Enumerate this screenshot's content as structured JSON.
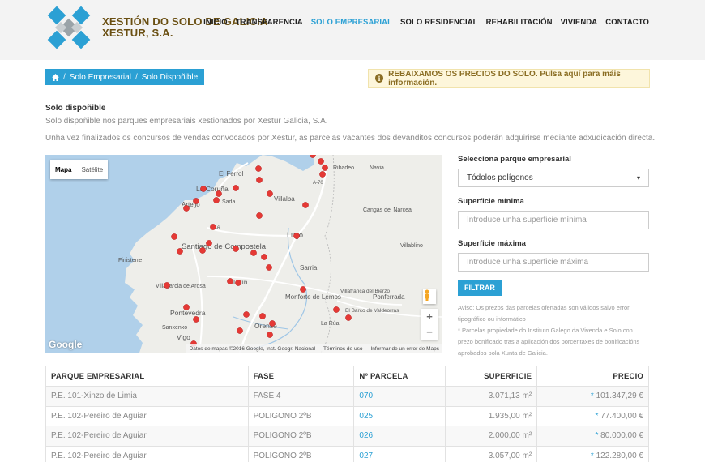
{
  "brand": {
    "line1": "XESTIÓN DO SOLO DE GALICIA",
    "line2": "XESTUR, S.A."
  },
  "nav": [
    {
      "label": "INICIO",
      "active": false
    },
    {
      "label": "TRANSPARENCIA",
      "active": false
    },
    {
      "label": "SOLO EMPRESARIAL",
      "active": true
    },
    {
      "label": "SOLO RESIDENCIAL",
      "active": false
    },
    {
      "label": "REHABILITACIÓN",
      "active": false
    },
    {
      "label": "VIVIENDA",
      "active": false
    },
    {
      "label": "CONTACTO",
      "active": false
    }
  ],
  "breadcrumb": {
    "level1": "Solo Empresarial",
    "level2": "Solo Dispoñible"
  },
  "alert": {
    "text": "REBAIXAMOS OS PRECIOS DO SOLO. Pulsa aquí para máis información."
  },
  "intro": {
    "title": "Solo dispoñible",
    "line1": "Solo dispoñible nos parques empresariais xestionados por Xestur Galicia, S.A.",
    "line2": "Unha vez finalizados os concursos de vendas convocados por Xestur, as parcelas vacantes dos devanditos concursos poderán adquirirse mediante adxudicación directa."
  },
  "map": {
    "type_map": "Mapa",
    "type_sat": "Satélite",
    "google": "Google",
    "attrib1": "Datos de mapas ©2016 Google, Inst. Geogr. Nacional",
    "attrib2": "Términos de uso",
    "attrib3": "Informar de un error de Maps",
    "places": {
      "ferrol": "El Ferrol",
      "coruna": "La Coruña",
      "arteijo": "Arteijo",
      "sada": "Sada",
      "villalba": "Villalba",
      "ribadeo": "Ribadeo",
      "navia": "Navia",
      "cangas": "Cangas del Narcea",
      "lugo": "Lugo",
      "santiago": "Santiago de Compostela",
      "finisterre": "Finisterre",
      "sarria": "Sarria",
      "villablino": "Villablino",
      "villagarcia": "Villagarcia de Arosa",
      "lalin": "Lalín",
      "monforte": "Monforte de Lemos",
      "villafranca": "Villafranca del Bierzo",
      "ponferrada": "Ponferrada",
      "pontevedra": "Pontevedra",
      "barco": "El Barco de Valdeorras",
      "sanxenxo": "Sanxenxo",
      "orense": "Orense",
      "larua": "La Rúa",
      "vigo": "Vigo",
      "a70": "A-70",
      "a6": "A-6"
    }
  },
  "filters": {
    "park_label": "Selecciona parque empresarial",
    "park_value": "Tódolos polígonos",
    "min_label": "Superficie mínima",
    "min_placeholder": "Introduce unha superficie mínima",
    "max_label": "Superficie máxima",
    "max_placeholder": "Introduce unha superficie máxima",
    "button": "FILTRAR",
    "note1": "Aviso: Os prezos das parcelas ofertadas son válidos salvo error tipográfico ou informático",
    "note2": "* Parcelas propiedade do Instituto Galego da Vivenda e Solo con prezo bonificado tras a aplicación dos porcentaxes de bonificacións aprobados pola Xunta de Galicia."
  },
  "table": {
    "headers": [
      "PARQUE EMPRESARIAL",
      "FASE",
      "Nº PARCELA",
      "SUPERFICIE",
      "PRECIO"
    ],
    "rows": [
      {
        "park": "P.E. 101-Xinzo de Limia",
        "phase": "FASE 4",
        "parcel": "070",
        "area": "3.071,13  m²",
        "price": "101.347,29  €"
      },
      {
        "park": "P.E. 102-Pereiro de Aguiar",
        "phase": "POLIGONO 2ºB",
        "parcel": "025",
        "area": "1.935,00  m²",
        "price": "77.400,00  €"
      },
      {
        "park": "P.E. 102-Pereiro de Aguiar",
        "phase": "POLIGONO 2ºB",
        "parcel": "026",
        "area": "2.000,00  m²",
        "price": "80.000,00  €"
      },
      {
        "park": "P.E. 102-Pereiro de Aguiar",
        "phase": "POLIGONO 2ºB",
        "parcel": "027",
        "area": "3.057,00  m²",
        "price": "122.280,00  €"
      }
    ],
    "star": "*"
  }
}
